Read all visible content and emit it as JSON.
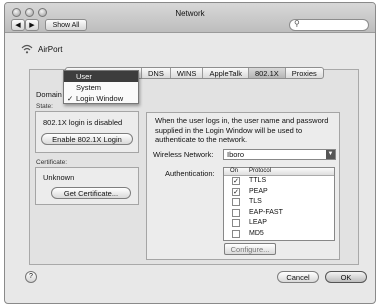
{
  "window": {
    "title": "Network"
  },
  "toolbar": {
    "show_all_label": "Show All",
    "search_placeholder": ""
  },
  "service": {
    "name": "AirPort"
  },
  "tabs": [
    "DNS",
    "WINS",
    "AppleTalk",
    "802.1X",
    "Proxies"
  ],
  "active_tab": "802.1X",
  "domain_menu": {
    "label": "Domain",
    "items": [
      {
        "label": "User",
        "checked": false,
        "highlighted": true
      },
      {
        "label": "System",
        "checked": false,
        "highlighted": false
      },
      {
        "label": "Login Window",
        "checked": true,
        "highlighted": false
      }
    ],
    "check_glyph": "✓"
  },
  "state": {
    "label": "State:",
    "value": "802.1X login is disabled",
    "enable_button": "Enable 802.1X Login"
  },
  "certificate": {
    "label": "Certificate:",
    "value": "Unknown",
    "get_button": "Get Certificate..."
  },
  "description": "When the user logs in, the user name and password supplied in the Login Window will be used to authenticate to the network.",
  "wireless": {
    "label": "Wireless Network:",
    "value": "Iboro"
  },
  "authentication": {
    "label": "Authentication:",
    "col_on": "On",
    "col_protocol": "Protocol",
    "protocols": [
      {
        "name": "TTLS",
        "on": true
      },
      {
        "name": "PEAP",
        "on": true
      },
      {
        "name": "TLS",
        "on": false
      },
      {
        "name": "EAP-FAST",
        "on": false
      },
      {
        "name": "LEAP",
        "on": false
      },
      {
        "name": "MD5",
        "on": false
      }
    ],
    "configure_button": "Configure..."
  },
  "footer": {
    "help_label": "?",
    "cancel_label": "Cancel",
    "ok_label": "OK"
  },
  "colors": {
    "window_bg": "#e8e8e8",
    "highlight": "#3d3d3d"
  }
}
